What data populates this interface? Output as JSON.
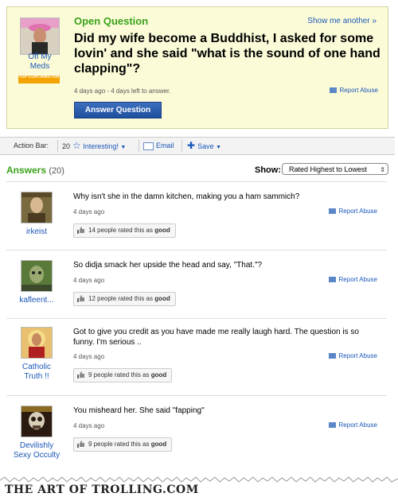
{
  "question": {
    "label": "Open Question",
    "show_another": "Show me another »",
    "title": "Did my wife become a Buddhist, I asked for some lovin' and she said \"what is the sound of one hand clapping\"?",
    "meta": "4 days ago - 4 days left to answer.",
    "report": "Report Abuse",
    "answer_button": "Answer Question",
    "asker": {
      "name": "Off My Meds",
      "badge": "TOP CONTRIBUTOR"
    }
  },
  "action_bar": {
    "label": "Action Bar:",
    "interesting_count": "20",
    "interesting": "Interesting!",
    "email": "Email",
    "save": "Save"
  },
  "answers": {
    "title": "Answers",
    "count": "(20)",
    "show_label": "Show:",
    "sort_selected": "Rated Highest to Lowest",
    "items": [
      {
        "user": "irkeist",
        "text": "Why isn't she in the damn kitchen, making you a ham sammich?",
        "time": "4 days ago",
        "report": "Report Abuse",
        "rating_prefix": "14 people rated this as",
        "rating_word": "good"
      },
      {
        "user": "kafleent...",
        "text": "So didja smack her upside the head and say, \"That.\"?",
        "time": "4 days ago",
        "report": "Report Abuse",
        "rating_prefix": "12 people rated this as",
        "rating_word": "good"
      },
      {
        "user": "Catholic Truth !!",
        "text": "Got to give you credit as you have made me really laugh hard. The question is so funny. I'm serious ..",
        "time": "4 days ago",
        "report": "Report Abuse",
        "rating_prefix": "9 people rated this as",
        "rating_word": "good"
      },
      {
        "user": "Devilishly Sexy Occulty",
        "text": "You misheard her. She said \"fapping\"",
        "time": "4 days ago",
        "report": "Report Abuse",
        "rating_prefix": "9 people rated this as",
        "rating_word": "good"
      }
    ]
  },
  "footer": {
    "logo": "THE ART OF TROLLING.COM"
  },
  "colors": {
    "accent_green": "#3aa21a",
    "link_blue": "#1a57b8",
    "button_blue": "#1d4f9e",
    "question_bg": "#fbfbd8"
  }
}
